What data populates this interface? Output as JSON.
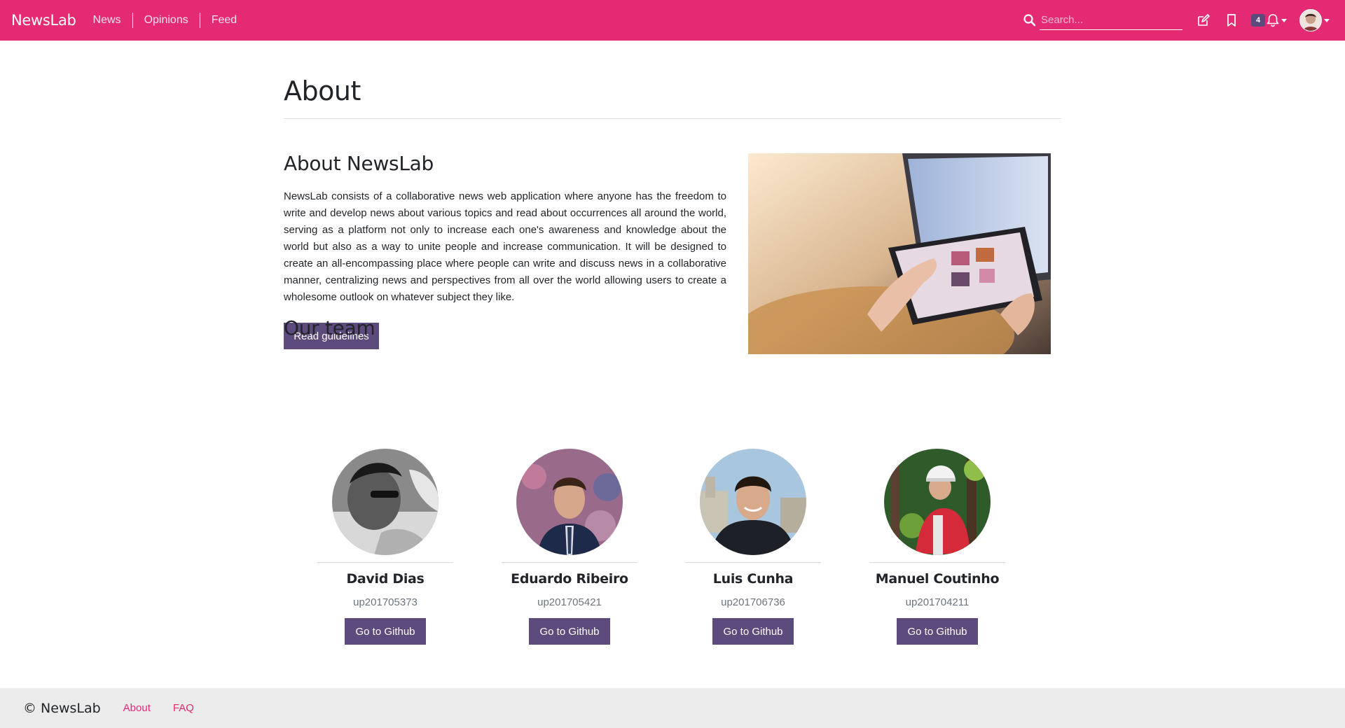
{
  "navbar": {
    "brand": "NewsLab",
    "links": [
      "News",
      "Opinions",
      "Feed"
    ],
    "search_placeholder": "Search...",
    "icons": [
      "search-icon",
      "edit-icon",
      "bookmark-icon",
      "bell-icon",
      "avatar"
    ],
    "notification_count": "4",
    "color": "#e42a72"
  },
  "page": {
    "title": "About",
    "about_heading": "About NewsLab",
    "about_text": "NewsLab consists of a collaborative news web application where anyone has the freedom to write and develop news about various topics and read about occurrences all around the world, serving as a platform not only to increase each one's awareness and knowledge about the world but also as a way to unite people and increase communication. It will be designed to create an all-encompassing place where people can write and discuss news in a collaborative manner, centralizing news and perspectives from all over the world allowing users to create a wholesome outlook on whatever subject they like.",
    "guidelines_button": "Read guidelines",
    "team_heading": "Our team",
    "button_color": "#5e4b7d"
  },
  "team": [
    {
      "name": "David Dias",
      "id": "up201705373",
      "button": "Go to Github"
    },
    {
      "name": "Eduardo Ribeiro",
      "id": "up201705421",
      "button": "Go to Github"
    },
    {
      "name": "Luis Cunha",
      "id": "up201706736",
      "button": "Go to Github"
    },
    {
      "name": "Manuel Coutinho",
      "id": "up201704211",
      "button": "Go to Github"
    }
  ],
  "footer": {
    "copyright": "© NewsLab",
    "links": [
      "About",
      "FAQ"
    ]
  }
}
